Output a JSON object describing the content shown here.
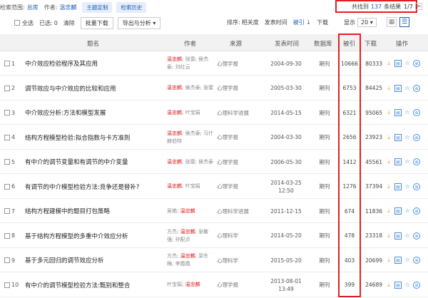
{
  "topbar": {
    "scope_label": "检索范围:",
    "scope_value": "总库",
    "author_label": "作者:",
    "author_value": "温忠麟",
    "topic_pill": "主题定制",
    "history_pill": "检索历史",
    "result_prefix": "共找到",
    "result_count": "137",
    "result_suffix": "条结果",
    "page_indicator": "1/7",
    "next_arrow": ">"
  },
  "toolbar": {
    "select_all": "全选",
    "selected_label": "已选:",
    "selected_count": "0",
    "clear": "清除",
    "batch_download": "批量下载",
    "export_analyze": "导出与分析 ▾",
    "sort_label": "排序:",
    "sort_relevance": "相关度",
    "sort_date": "发表时间",
    "sort_cited": "被引 ↓",
    "sort_download": "下载",
    "show_label": "显示",
    "show_value": "20 ▾",
    "grid_icon": "▦",
    "list_icon": "☰"
  },
  "columns": {
    "title": "题名",
    "author": "作者",
    "source": "来源",
    "date": "发表时间",
    "db": "数据库",
    "cited": "被引",
    "download": "下载",
    "ops": "操作"
  },
  "rows": [
    {
      "idx": "1",
      "title": "中介效应检验程序及其应用",
      "author_hl": "温忠麟",
      "author_rest": "; 张雷; 侯杰泰; 刘红云",
      "source": "心理学报",
      "date": "2004-09-30",
      "db": "期刊",
      "cited": "10666",
      "download": "80333"
    },
    {
      "idx": "2",
      "title": "调节效应与中介效应的比较和应用",
      "author_hl": "温忠麟",
      "author_rest": "; 侯杰泰; 张雷",
      "source": "心理学报",
      "date": "2005-03-30",
      "db": "期刊",
      "cited": "6753",
      "download": "84425"
    },
    {
      "idx": "3",
      "title": "中介效应分析:方法和模型发展",
      "author_hl": "温忠麟",
      "author_rest": "; 叶宝娟",
      "source": "心理科学进展",
      "date": "2014-05-15",
      "db": "期刊",
      "cited": "6321",
      "download": "95065"
    },
    {
      "idx": "4",
      "title": "结构方程模型检验:拟合指数与卡方准则",
      "author_hl": "温忠麟",
      "author_rest": "; 侯杰泰; 马什赫伯特",
      "source": "心理学报",
      "date": "2004-03-30",
      "db": "期刊",
      "cited": "2656",
      "download": "23923"
    },
    {
      "idx": "5",
      "title": "有中介的调节变量和有调节的中介变量",
      "author_hl": "温忠麟",
      "author_rest": "; 张雷; 侯杰泰",
      "source": "心理学报",
      "date": "2006-05-30",
      "db": "期刊",
      "cited": "1412",
      "download": "45561"
    },
    {
      "idx": "6",
      "title": "有调节的中介模型检验方法:竞争还是替补?",
      "author_hl": "温忠麟",
      "author_rest": "; 叶宝娟",
      "source": "心理学报",
      "date": "2014-03-25 12:50",
      "db": "期刊",
      "cited": "1276",
      "download": "37394"
    },
    {
      "idx": "7",
      "title": "结构方程建模中的题目打包策略",
      "author_pre": "吴艳; ",
      "author_hl": "温忠麟",
      "author_rest": "",
      "source": "心理科学进展",
      "date": "2011-12-15",
      "db": "期刊",
      "cited": "674",
      "download": "11836"
    },
    {
      "idx": "8",
      "title": "基于结构方程模型的多重中介效应分析",
      "author_pre": "方杰; ",
      "author_hl": "温忠麟",
      "author_rest": "; 张敏强; 孙配贞",
      "source": "心理科学",
      "date": "2014-05-20",
      "db": "期刊",
      "cited": "478",
      "download": "23318"
    },
    {
      "idx": "9",
      "title": "基于多元回归的调节效应分析",
      "author_pre": "方杰; ",
      "author_hl": "温忠麟",
      "author_rest": "; 梁东梅; 李霞霞",
      "source": "心理科学",
      "date": "2015-05-20",
      "db": "期刊",
      "cited": "403",
      "download": "20699"
    },
    {
      "idx": "10",
      "title": "有中介的调节模型检验方法:甄别和整合",
      "author_pre": "叶宝娟; ",
      "author_hl": "温忠麟",
      "author_rest": "",
      "source": "心理学报",
      "date": "2013-08-01 13:49",
      "db": "期刊",
      "cited": "399",
      "download": "24689"
    }
  ],
  "icons": {
    "download": "⤓",
    "read": "▤",
    "favorite": "☆",
    "more": "⊕"
  }
}
